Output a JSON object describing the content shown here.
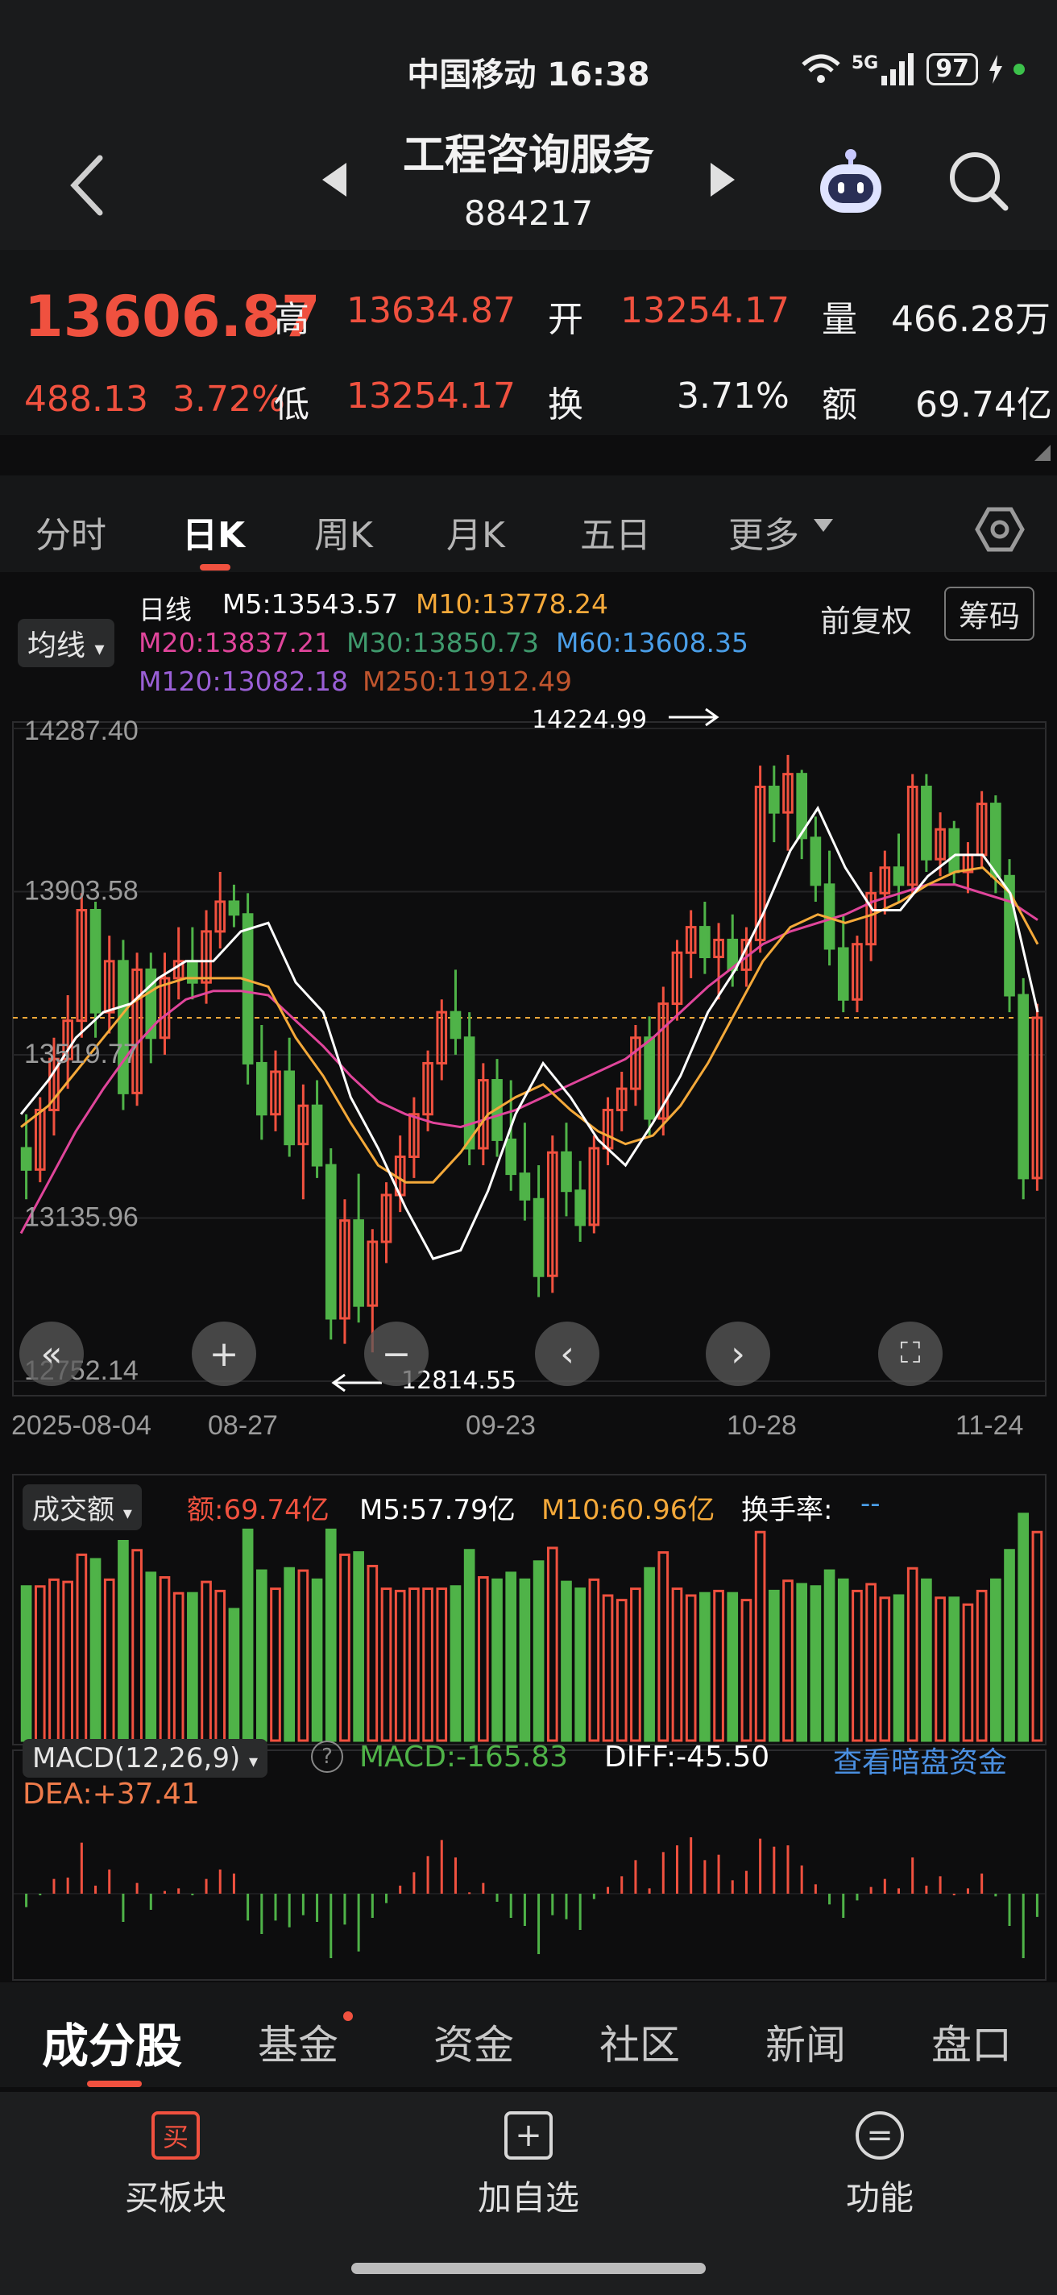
{
  "status": {
    "carrier_time": "中国移动 16:38",
    "battery": "97",
    "network": "5G"
  },
  "header": {
    "title": "工程咨询服务",
    "code": "884217"
  },
  "quote": {
    "price": "13606.87",
    "change": "488.13",
    "change_pct": "3.72%",
    "high_label": "高",
    "high": "13634.87",
    "low_label": "低",
    "low": "13254.17",
    "open_label": "开",
    "open": "13254.17",
    "turnover_label": "换",
    "turnover": "3.71%",
    "volume_label": "量",
    "volume": "466.28万",
    "amount_label": "额",
    "amount": "69.74亿"
  },
  "period_tabs": [
    "分时",
    "日K",
    "周K",
    "月K",
    "五日",
    "更多"
  ],
  "ma_legend": {
    "selector": "均线",
    "line_type": "日线",
    "m5": "M5:13543.57",
    "m10": "M10:13778.24",
    "m20": "M20:13837.21",
    "m30": "M30:13850.73",
    "m60": "M60:13608.35",
    "m120": "M120:13082.18",
    "m250": "M250:11912.49",
    "adjust": "前复权",
    "chips": "筹码"
  },
  "colors": {
    "up": "#f0513f",
    "down": "#4fb348",
    "m5": "#ffffff",
    "m10": "#f4a93a",
    "m20": "#e0459b",
    "m30": "#3f9a6d",
    "m60": "#4a9ee8",
    "m120": "#9a5fd6",
    "m250": "#c0552e"
  },
  "chart_data": {
    "type": "candlestick",
    "y_ticks": [
      "14287.40",
      "13903.58",
      "13519.77",
      "13135.96",
      "12752.14"
    ],
    "ylim": [
      12752.14,
      14287.4
    ],
    "x_ticks": [
      "2025-08-04",
      "08-27",
      "09-23",
      "10-28",
      "11-24"
    ],
    "max_label": "14224.99",
    "min_label": "12814.55",
    "last_close": 13606.87,
    "candles": [
      [
        13300,
        13380,
        13180,
        13250
      ],
      [
        13250,
        13420,
        13220,
        13390
      ],
      [
        13390,
        13560,
        13330,
        13510
      ],
      [
        13510,
        13660,
        13440,
        13600
      ],
      [
        13600,
        13900,
        13560,
        13860
      ],
      [
        13860,
        13880,
        13560,
        13620
      ],
      [
        13620,
        13800,
        13570,
        13740
      ],
      [
        13740,
        13790,
        13390,
        13430
      ],
      [
        13430,
        13760,
        13400,
        13720
      ],
      [
        13720,
        13760,
        13500,
        13560
      ],
      [
        13560,
        13760,
        13520,
        13700
      ],
      [
        13700,
        13820,
        13650,
        13740
      ],
      [
        13740,
        13820,
        13650,
        13690
      ],
      [
        13690,
        13860,
        13640,
        13810
      ],
      [
        13810,
        13950,
        13770,
        13880
      ],
      [
        13880,
        13920,
        13820,
        13850
      ],
      [
        13850,
        13900,
        13450,
        13500
      ],
      [
        13500,
        13590,
        13320,
        13380
      ],
      [
        13380,
        13530,
        13340,
        13480
      ],
      [
        13480,
        13560,
        13280,
        13310
      ],
      [
        13310,
        13450,
        13180,
        13400
      ],
      [
        13400,
        13460,
        13230,
        13260
      ],
      [
        13260,
        13300,
        12850,
        12900
      ],
      [
        12900,
        13180,
        12840,
        13130
      ],
      [
        13130,
        13240,
        12890,
        12930
      ],
      [
        12930,
        13110,
        12820,
        13080
      ],
      [
        13080,
        13220,
        13030,
        13190
      ],
      [
        13190,
        13330,
        13150,
        13280
      ],
      [
        13280,
        13420,
        13230,
        13380
      ],
      [
        13380,
        13530,
        13340,
        13500
      ],
      [
        13500,
        13650,
        13460,
        13620
      ],
      [
        13620,
        13720,
        13520,
        13560
      ],
      [
        13560,
        13620,
        13260,
        13300
      ],
      [
        13300,
        13500,
        13260,
        13460
      ],
      [
        13460,
        13510,
        13280,
        13320
      ],
      [
        13320,
        13460,
        13200,
        13240
      ],
      [
        13240,
        13360,
        13130,
        13180
      ],
      [
        13180,
        13260,
        12950,
        13000
      ],
      [
        13000,
        13330,
        12960,
        13290
      ],
      [
        13290,
        13360,
        13140,
        13200
      ],
      [
        13200,
        13270,
        13080,
        13120
      ],
      [
        13120,
        13330,
        13100,
        13300
      ],
      [
        13300,
        13420,
        13260,
        13390
      ],
      [
        13390,
        13480,
        13340,
        13440
      ],
      [
        13440,
        13590,
        13400,
        13560
      ],
      [
        13560,
        13610,
        13330,
        13370
      ],
      [
        13370,
        13680,
        13330,
        13640
      ],
      [
        13640,
        13790,
        13600,
        13760
      ],
      [
        13760,
        13860,
        13700,
        13820
      ],
      [
        13820,
        13880,
        13710,
        13750
      ],
      [
        13750,
        13830,
        13650,
        13790
      ],
      [
        13790,
        13850,
        13680,
        13720
      ],
      [
        13720,
        13820,
        13680,
        13790
      ],
      [
        13790,
        14200,
        13760,
        14150
      ],
      [
        14150,
        14200,
        14020,
        14090
      ],
      [
        14090,
        14225,
        14000,
        14180
      ],
      [
        14180,
        14190,
        13980,
        14030
      ],
      [
        14030,
        14080,
        13880,
        13920
      ],
      [
        13920,
        14000,
        13730,
        13770
      ],
      [
        13770,
        13850,
        13620,
        13650
      ],
      [
        13650,
        13800,
        13620,
        13780
      ],
      [
        13780,
        13950,
        13740,
        13900
      ],
      [
        13900,
        14000,
        13850,
        13960
      ],
      [
        13960,
        14040,
        13880,
        13920
      ],
      [
        13920,
        14180,
        13900,
        14150
      ],
      [
        14150,
        14180,
        13950,
        13980
      ],
      [
        13980,
        14090,
        13940,
        14050
      ],
      [
        14050,
        14070,
        13920,
        13950
      ],
      [
        13950,
        14020,
        13900,
        13990
      ],
      [
        13990,
        14140,
        13960,
        14110
      ],
      [
        14110,
        14130,
        13900,
        13940
      ],
      [
        13940,
        13980,
        13620,
        13660
      ],
      [
        13660,
        13700,
        13180,
        13230
      ],
      [
        13230,
        13640,
        13200,
        13606.87
      ]
    ],
    "ma_series": {
      "m5": [
        13380,
        13460,
        13560,
        13620,
        13640,
        13700,
        13740,
        13740,
        13810,
        13830,
        13690,
        13620,
        13420,
        13300,
        13160,
        13040,
        13060,
        13200,
        13380,
        13500,
        13420,
        13320,
        13260,
        13360,
        13470,
        13620,
        13720,
        13850,
        14000,
        14100,
        13960,
        13860,
        13860,
        13940,
        13990,
        13990,
        13900,
        13620
      ],
      "m10": [
        13350,
        13400,
        13480,
        13560,
        13640,
        13680,
        13700,
        13700,
        13700,
        13680,
        13560,
        13470,
        13360,
        13260,
        13220,
        13220,
        13290,
        13380,
        13420,
        13450,
        13390,
        13340,
        13310,
        13330,
        13400,
        13500,
        13620,
        13740,
        13820,
        13850,
        13830,
        13850,
        13880,
        13920,
        13950,
        13960,
        13900,
        13780
      ],
      "m20": [
        13100,
        13220,
        13340,
        13440,
        13530,
        13600,
        13650,
        13670,
        13670,
        13660,
        13600,
        13540,
        13470,
        13410,
        13380,
        13360,
        13350,
        13370,
        13390,
        13420,
        13450,
        13480,
        13510,
        13560,
        13620,
        13680,
        13730,
        13780,
        13810,
        13830,
        13850,
        13880,
        13900,
        13920,
        13920,
        13900,
        13880,
        13837
      ]
    },
    "volume": {
      "label": "成交额",
      "amount": "额:69.74亿",
      "m5": "M5:57.79亿",
      "m10": "M10:60.96亿",
      "turnover": "换手率:",
      "turnover_value": "--"
    },
    "macd": {
      "label": "MACD(12,26,9)",
      "macd": "MACD:-165.83",
      "diff": "DIFF:-45.50",
      "dea": "DEA:+37.41",
      "link": "查看暗盘资金"
    }
  },
  "bottom_tabs": [
    "成分股",
    "基金",
    "资金",
    "社区",
    "新闻",
    "盘口"
  ],
  "actions": [
    {
      "label": "买板块",
      "icon": "买"
    },
    {
      "label": "加自选",
      "icon": "+"
    },
    {
      "label": "功能",
      "icon": "="
    }
  ]
}
